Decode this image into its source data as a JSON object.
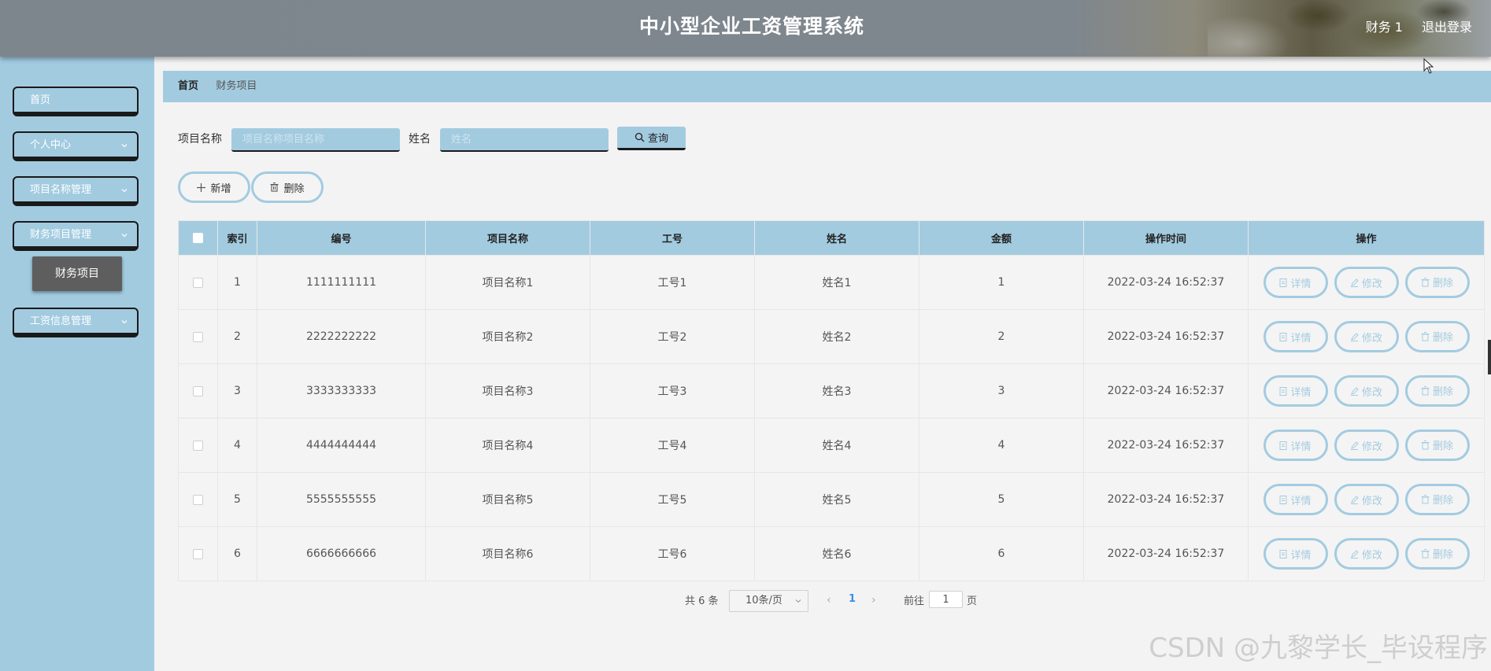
{
  "header": {
    "title": "中小型企业工资管理系统",
    "user": "财务 1",
    "logout": "退出登录"
  },
  "sidebar": {
    "items": [
      {
        "label": "首页"
      },
      {
        "label": "个人中心"
      },
      {
        "label": "项目名称管理"
      },
      {
        "label": "财务项目管理"
      },
      {
        "label": "工资信息管理"
      }
    ],
    "submenu": "财务项目"
  },
  "breadcrumb": {
    "home": "首页",
    "separator": "/",
    "current": "财务项目"
  },
  "search": {
    "project_label": "项目名称",
    "project_placeholder": "项目名称项目名称",
    "name_label": "姓名",
    "name_placeholder": "姓名",
    "query_label": "查询"
  },
  "actions": {
    "add_label": "新增",
    "delete_label": "删除"
  },
  "table": {
    "headers": [
      "索引",
      "编号",
      "项目名称",
      "工号",
      "姓名",
      "金额",
      "操作时间",
      "操作"
    ],
    "rows": [
      {
        "index": "1",
        "code": "1111111111",
        "project": "项目名称1",
        "job_no": "工号1",
        "name": "姓名1",
        "amount": "1",
        "time": "2022-03-24 16:52:37"
      },
      {
        "index": "2",
        "code": "2222222222",
        "project": "项目名称2",
        "job_no": "工号2",
        "name": "姓名2",
        "amount": "2",
        "time": "2022-03-24 16:52:37"
      },
      {
        "index": "3",
        "code": "3333333333",
        "project": "项目名称3",
        "job_no": "工号3",
        "name": "姓名3",
        "amount": "3",
        "time": "2022-03-24 16:52:37"
      },
      {
        "index": "4",
        "code": "4444444444",
        "project": "项目名称4",
        "job_no": "工号4",
        "name": "姓名4",
        "amount": "4",
        "time": "2022-03-24 16:52:37"
      },
      {
        "index": "5",
        "code": "5555555555",
        "project": "项目名称5",
        "job_no": "工号5",
        "name": "姓名5",
        "amount": "5",
        "time": "2022-03-24 16:52:37"
      },
      {
        "index": "6",
        "code": "6666666666",
        "project": "项目名称6",
        "job_no": "工号6",
        "name": "姓名6",
        "amount": "6",
        "time": "2022-03-24 16:52:37"
      }
    ],
    "row_actions": {
      "detail": "详情",
      "edit": "修改",
      "delete": "删除"
    }
  },
  "pagination": {
    "total": "共 6 条",
    "page_size": "10条/页",
    "prev": "‹",
    "current_page": "1",
    "next": "›",
    "goto_label": "前往",
    "goto_value": "1",
    "page_suffix": "页"
  },
  "watermark": "CSDN @九黎学长_毕设程序"
}
